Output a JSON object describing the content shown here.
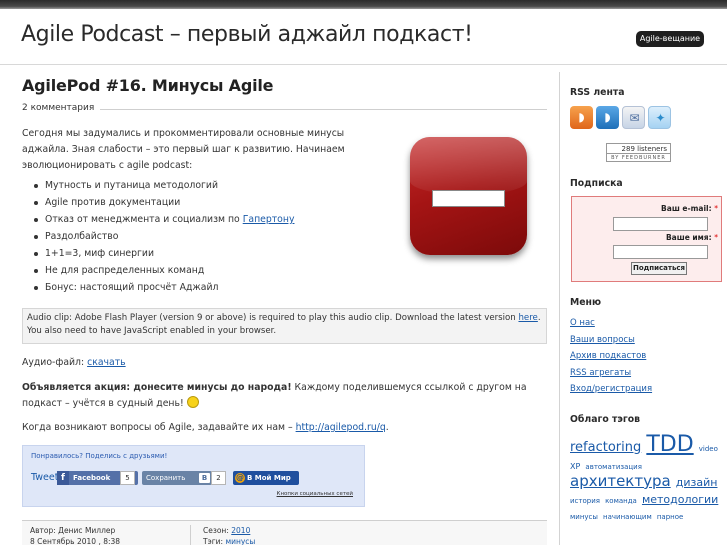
{
  "site": {
    "title": "Agile Podcast – первый аджайл подкаст!",
    "tagline": "Agile-вещание"
  },
  "post": {
    "title": "AgilePod #16. Минусы Agile",
    "comments": "2 комментария",
    "intro": "Сегодня мы задумались и прокомментировали основные минусы аджайла. Зная слабости – это первый шаг к развитию. Начинаем эволюционировать с agile podcast:",
    "bullets": [
      "Мутность и путаница методологий",
      "Agile против документации",
      "Отказ от менеджмента и социализм по ",
      "Раздолбайство",
      "1+1=3, миф синергии",
      "Не для распределенных команд",
      "Бонус: настоящий просчёт Аджайл"
    ],
    "bullet_link": "Гапертону",
    "audio_notice_1": "Audio clip: Adobe Flash Player (version 9 or above) is required to play this audio clip. Download the latest version ",
    "audio_notice_link": "here",
    "audio_notice_2": ". You also need to have JavaScript enabled in your browser.",
    "audio_file_label": "Аудио-файл: ",
    "audio_file_link": "скачать",
    "promo_bold": "Объявляется акция: донесите минусы до народа!",
    "promo_text": " Каждому поделившемуся ссылкой с другом на подкаст – учётся в судный день! ",
    "questions_text": "Когда возникают вопросы об Agile, задавайте их нам – ",
    "questions_link": "http://agilepod.ru/q",
    "questions_end": "."
  },
  "share": {
    "title": "Понравилось? Поделись с друзьями!",
    "tweet": "Tweet",
    "facebook": "Facebook",
    "facebook_count": "5",
    "vk": "Сохранить",
    "vk_count": "2",
    "moimir": "В Мой Мир",
    "credit": "Кнопки социальных сетей"
  },
  "meta": {
    "author": "Автор: Денис Миллер",
    "date": "8 Сентябрь 2010 , 8:38",
    "season_label": "Сезон: ",
    "season": "2010",
    "tags_label": "Тэги: ",
    "tags": "минусы"
  },
  "sidebar": {
    "rss_heading": "RSS лента",
    "rss_icons": [
      "rss-feed-icon",
      "rss-comments-icon",
      "mail-subscribe-icon",
      "twitter-icon"
    ],
    "listeners": "289 listeners",
    "feedburner": "BY FEEDBURNER",
    "subscribe_heading": "Подписка",
    "email_label": "Ваш e-mail:",
    "name_label": "Ваше имя:",
    "required_mark": "*",
    "subscribe_button": "Подписаться",
    "menu_heading": "Меню",
    "menu": [
      "О нас",
      "Ваши вопросы",
      "Архив подкастов",
      "RSS агрегаты",
      "Вход/регистрация"
    ],
    "tags_heading": "Облаго тэгов",
    "tags": [
      {
        "label": "refactoring",
        "size": 13
      },
      {
        "label": "TDD",
        "size": 22
      },
      {
        "label": "video",
        "size": 7
      },
      {
        "label": "XP",
        "size": 8
      },
      {
        "label": "автоматизация",
        "size": 7
      },
      {
        "label": "архитектура",
        "size": 15
      },
      {
        "label": "дизайн",
        "size": 11
      },
      {
        "label": "история",
        "size": 7
      },
      {
        "label": "команда",
        "size": 7
      },
      {
        "label": "методологии",
        "size": 11
      },
      {
        "label": "минусы",
        "size": 7
      },
      {
        "label": "начинающим",
        "size": 7
      },
      {
        "label": "парное",
        "size": 7
      }
    ]
  },
  "colors": {
    "link": "#1a5aa8",
    "minus_icon": "#a41414",
    "subscribe_border": "#e07b7b"
  }
}
